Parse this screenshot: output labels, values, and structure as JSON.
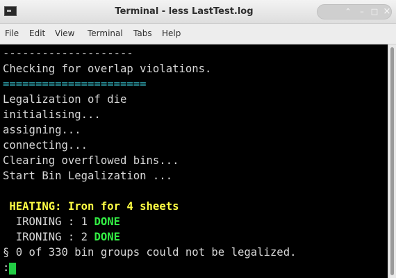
{
  "window": {
    "title": "Terminal - less LastTest.log",
    "icon": "terminal-icon",
    "controls": {
      "up": "⌃",
      "minimize": "–",
      "maximize": "□",
      "close": "×"
    }
  },
  "menubar": {
    "items": [
      "File",
      "Edit",
      "View",
      "Terminal",
      "Tabs",
      "Help"
    ]
  },
  "terminal": {
    "lines": [
      "--------------------",
      "Checking for overlap violations.",
      "======================",
      "Legalization of die",
      "initialising...",
      "assigning...",
      "connecting...",
      "Clearing overflowed bins...",
      "Start Bin Legalization ...",
      "",
      " HEATING: Iron for 4 sheets",
      "  IRONING : 1 ",
      "  IRONING : 2 ",
      "§ 0 of 330 bin groups could not be legalized.",
      ":"
    ],
    "done_label": "DONE",
    "colors": {
      "background": "#000000",
      "text": "#d8d8d8",
      "separator": "#40e0f0",
      "heating": "#ffff44",
      "done": "#33ee44",
      "cursor": "#22cc44"
    }
  }
}
